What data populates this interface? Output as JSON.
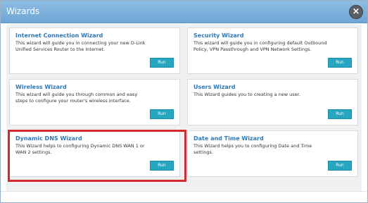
{
  "window": {
    "title": "Wizards",
    "close_label": "×"
  },
  "cards": [
    {
      "title": "Internet Connection Wizard",
      "desc": "This wizard will guide you in connecting your new D-Link Unified Services Router to the Internet.",
      "button": "Run"
    },
    {
      "title": "Security Wizard",
      "desc": "This wizard will guide you in configuring default Outbound Policy, VPN Passthrough and VPN Network Settings.",
      "button": "Run"
    },
    {
      "title": "Wireless Wizard",
      "desc": "This wizard will guide you through common and easy steps to configure your router's wireless interface.",
      "button": "Run"
    },
    {
      "title": "Users Wizard",
      "desc": "This Wizard guides you to creating a new user.",
      "button": "Run"
    },
    {
      "title": "Dynamic DNS Wizard",
      "desc": "This Wizard helps to configuring Dynamic DNS WAN 1 or WAN 2 settings.",
      "button": "Run"
    },
    {
      "title": "Date and Time Wizard",
      "desc": "This Wizard helps you to configuring Date and Time settings.",
      "button": "Run"
    }
  ],
  "colors": {
    "title_bar": "#7fb2de",
    "card_title": "#2d78b8",
    "run_button": "#27a6c1",
    "highlight": "#d42a2f"
  }
}
